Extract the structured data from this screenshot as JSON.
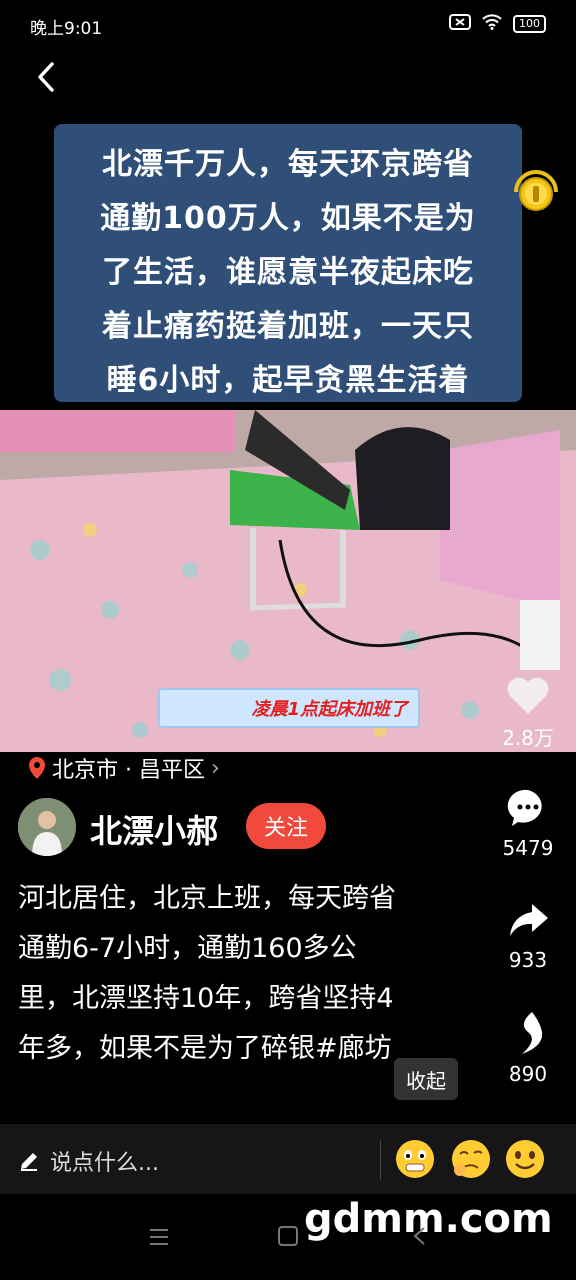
{
  "status": {
    "time": "晚上9:01",
    "battery": "100"
  },
  "caption": {
    "lines": [
      "北漂千万人，每天环京跨省",
      "通勤100万人，如果不是为",
      "了生活，谁愿意半夜起床吃",
      "着止痛药挺着加班，一天只",
      "睡6小时，起早贪黑生活着"
    ]
  },
  "photo_banner": "凌晨1点起床加班了",
  "actions": {
    "likes": "2.8万",
    "comments": "5479",
    "shares": "933",
    "collects": "890"
  },
  "location": {
    "text": "北京市 · 昌平区",
    "arrow": "›"
  },
  "author": {
    "name": "北漂小郝",
    "follow_label": "关注"
  },
  "description": {
    "lines": [
      "河北居住，北京上班，每天跨省",
      "通勤6-7小时，通勤160多公",
      "里，北漂坚持10年，跨省坚持4",
      "年多，如果不是为了碎银#廊坊"
    ],
    "collapse_label": "收起"
  },
  "comment_bar": {
    "placeholder": "说点什么..."
  },
  "watermark": "gdmm.com",
  "colors": {
    "accent": "#f2493d",
    "caption_bg": "#2f4f78"
  },
  "icons": [
    "back-icon",
    "coin-icon",
    "heart-icon",
    "comment-icon",
    "share-icon",
    "collect-icon",
    "location-pin-icon",
    "pencil-icon",
    "emoji-icon"
  ]
}
